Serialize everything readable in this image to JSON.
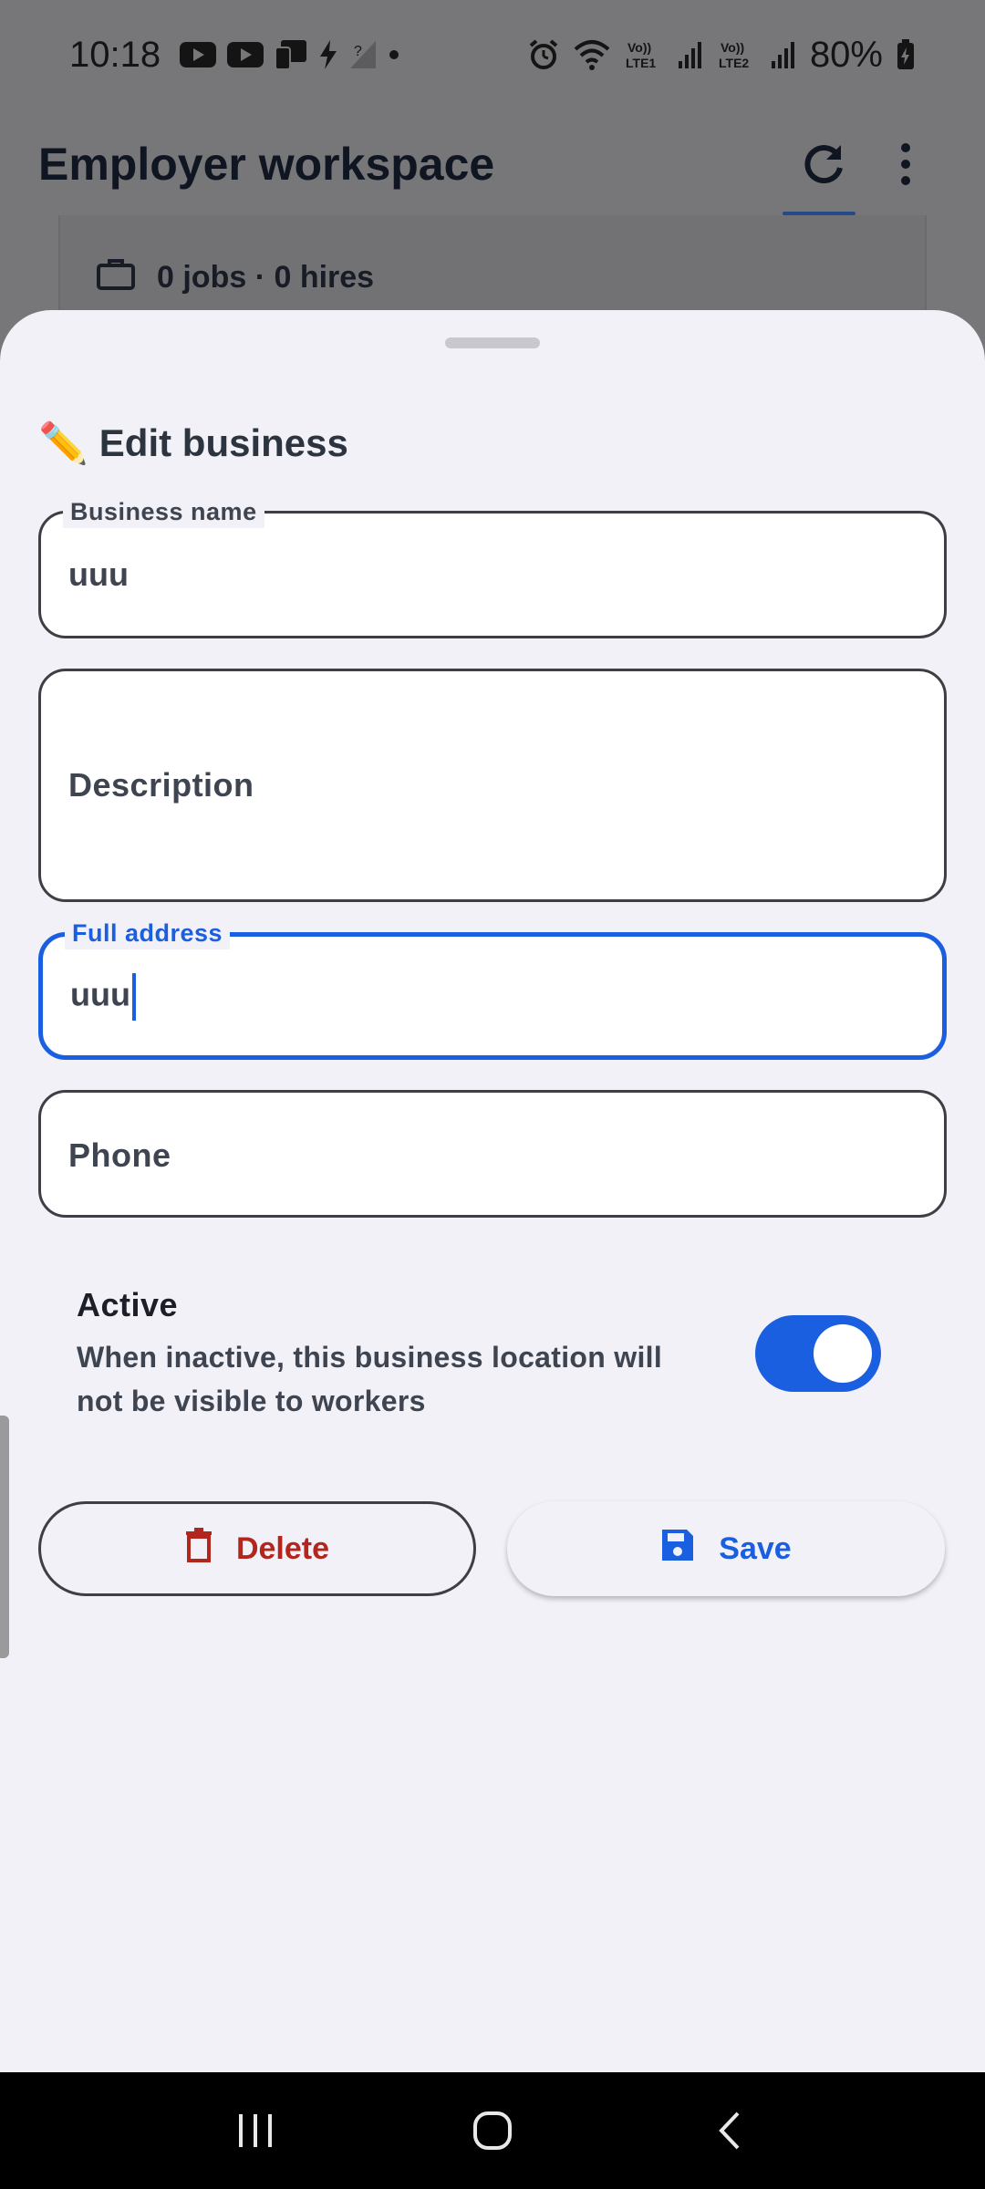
{
  "status_bar": {
    "time": "10:18",
    "battery": "80%",
    "icons": [
      "youtube-icon",
      "youtube-icon",
      "device-icon",
      "flash-icon",
      "signal-off-icon",
      "dot-icon",
      "alarm-icon",
      "wifi-icon",
      "volte-lte1-icon",
      "signal-icon",
      "volte-lte2-icon",
      "signal-icon",
      "battery-charging-icon"
    ]
  },
  "app_bar": {
    "title": "Employer workspace",
    "refresh_icon": "refresh-icon",
    "menu_icon": "more-vert-icon"
  },
  "background_card": {
    "stats": "0 jobs · 0 hires",
    "icon": "briefcase-icon"
  },
  "sheet": {
    "title_emoji": "✏️",
    "title": "Edit business",
    "fields": {
      "business_name": {
        "label": "Business name",
        "value": "uuu"
      },
      "description": {
        "placeholder": "Description",
        "value": ""
      },
      "full_address": {
        "label": "Full address",
        "value": "uuu"
      },
      "phone": {
        "placeholder": "Phone",
        "value": ""
      }
    },
    "active": {
      "title": "Active",
      "description": "When inactive, this business location will not be visible to workers",
      "enabled": true
    },
    "buttons": {
      "delete_label": "Delete",
      "save_label": "Save"
    }
  },
  "colors": {
    "accent": "#1a5fe0",
    "danger": "#b3261e",
    "sheet_bg": "#f2f1f7"
  }
}
